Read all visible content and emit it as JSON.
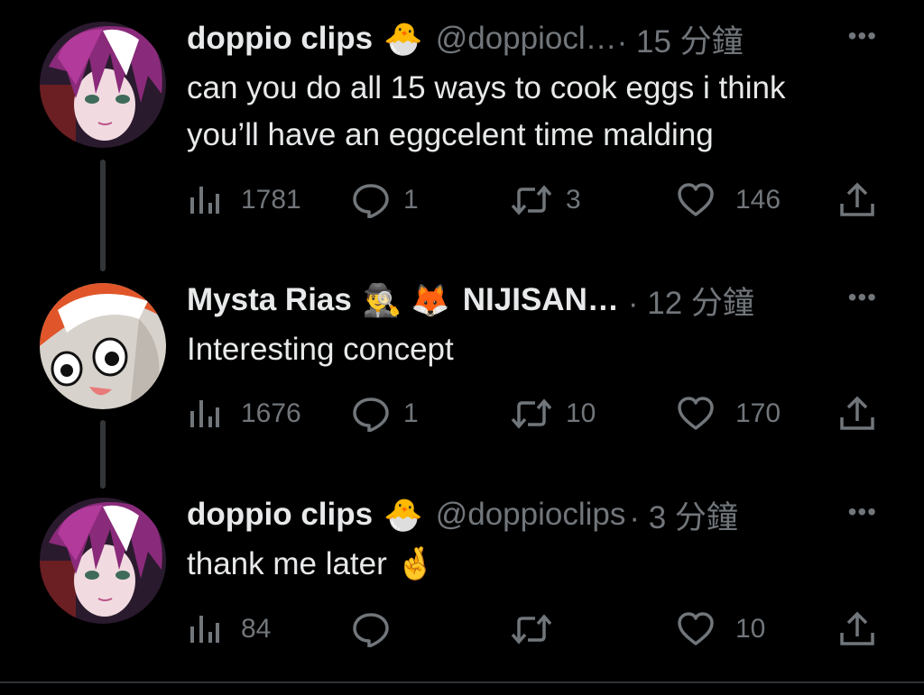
{
  "tweets": [
    {
      "name": "doppio clips",
      "name_emoji": "🐣",
      "handle": "@doppiocl…",
      "time": "· 15 分鐘",
      "more": "•••",
      "text_lines": [
        "can you do all 15 ways to cook eggs i think",
        "you’ll have an eggcelent time malding"
      ],
      "views": "1781",
      "replies": "1",
      "retweets": "3",
      "likes": "146"
    },
    {
      "name": "Mysta Rias",
      "name_emoji": "🕵️‍♂️ 🦊",
      "handle": "NIJISAN…",
      "time": "· 12 分鐘",
      "more": "•••",
      "text_lines": [
        "Interesting concept"
      ],
      "views": "1676",
      "replies": "1",
      "retweets": "10",
      "likes": "170"
    },
    {
      "name": "doppio clips",
      "name_emoji": "🐣",
      "handle": "@doppioclips",
      "time": "· 3 分鐘",
      "more": "•••",
      "text_lines": [
        "thank me later  🤞"
      ],
      "views": "84",
      "replies": "",
      "retweets": "",
      "likes": "10"
    }
  ],
  "colors": {
    "background": "#000000",
    "text": "#e7e9ea",
    "secondary": "#71767b",
    "thread_line": "#333639"
  },
  "icons": {
    "views": "bar-chart-icon",
    "reply": "speech-bubble-icon",
    "retweet": "retweet-arrows-icon",
    "like": "heart-icon",
    "share": "share-upload-icon",
    "more": "ellipsis-icon"
  }
}
